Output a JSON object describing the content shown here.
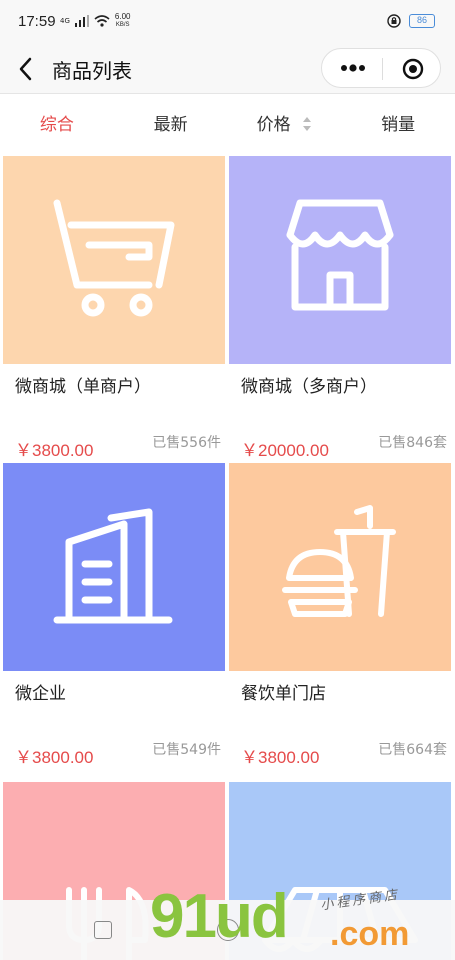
{
  "status_bar": {
    "time": "17:59",
    "network": "4G",
    "speed_value": "6.00",
    "speed_unit": "KB/S",
    "battery": "86"
  },
  "nav": {
    "title": "商品列表",
    "back_icon": "chevron-left-icon",
    "more_icon": "more-dots-icon",
    "close_icon": "target-close-icon"
  },
  "sort_tabs": [
    {
      "label": "综合",
      "active": true
    },
    {
      "label": "最新",
      "active": false
    },
    {
      "label": "价格",
      "active": false
    },
    {
      "label": "销量",
      "active": false
    }
  ],
  "colors": {
    "accent": "#e54b4b",
    "card1": "#fdd6ae",
    "card2": "#b5b3f8",
    "card3": "#7b8cf6",
    "card4": "#fdc99e",
    "card5": "#fcaeb1",
    "card6": "#a9c8f8"
  },
  "products": [
    {
      "name": "微商城（单商户）",
      "price": "￥3800.00",
      "sold": "已售556件",
      "icon": "shopping-cart-icon"
    },
    {
      "name": "微商城（多商户）",
      "price": "￥20000.00",
      "sold": "已售846套",
      "icon": "storefront-icon"
    },
    {
      "name": "微企业",
      "price": "￥3800.00",
      "sold": "已售549件",
      "icon": "office-building-icon"
    },
    {
      "name": "餐饮单门店",
      "price": "￥3800.00",
      "sold": "已售664套",
      "icon": "burger-drink-icon"
    },
    {
      "name": "",
      "price": "",
      "sold": "",
      "icon": "fork-knife-icon"
    },
    {
      "name": "",
      "price": "",
      "sold": "",
      "icon": "awning-shop-icon"
    }
  ],
  "watermark": {
    "main": "91ud",
    "domain": ".com",
    "sub": "小程序商店"
  }
}
